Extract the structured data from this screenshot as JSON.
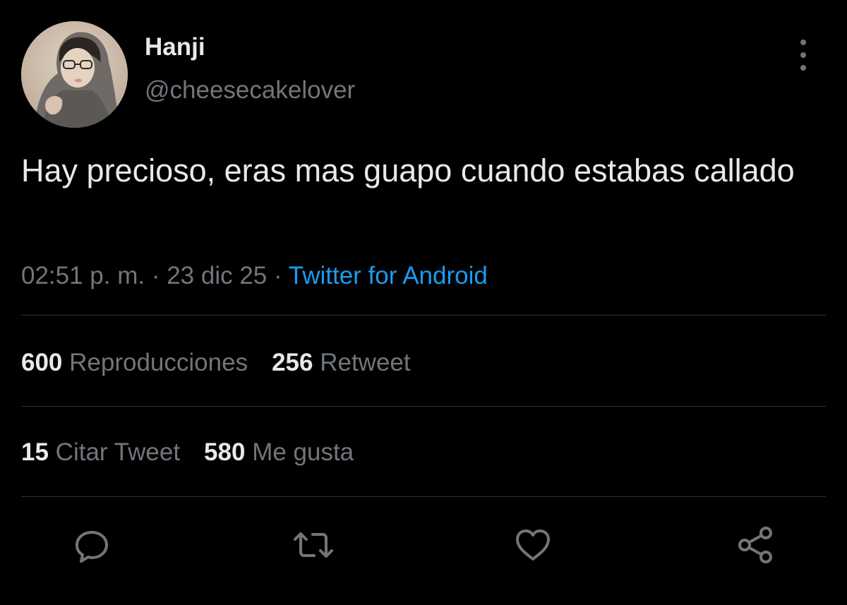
{
  "author": {
    "name": "Hanji",
    "handle": "@cheesecakelover"
  },
  "tweet": {
    "text": "Hay precioso, eras mas guapo cuando estabas callado",
    "time": "02:51 p. m.",
    "separator": " · ",
    "date": "23 dic 25",
    "source": "Twitter for Android"
  },
  "stats": {
    "views_count": "600",
    "views_label": "Reproducciones",
    "retweets_count": "256",
    "retweets_label": "Retweet",
    "quotes_count": "15",
    "quotes_label": "Citar Tweet",
    "likes_count": "580",
    "likes_label": "Me gusta"
  },
  "icons": {
    "reply": "reply-icon",
    "retweet": "retweet-icon",
    "like": "heart-icon",
    "share": "share-icon",
    "more": "more-options-icon"
  },
  "colors": {
    "background": "#000000",
    "primary_text": "#e7e9ea",
    "secondary_text": "#71767b",
    "accent": "#1d9bf0",
    "divider": "#2f3336"
  }
}
